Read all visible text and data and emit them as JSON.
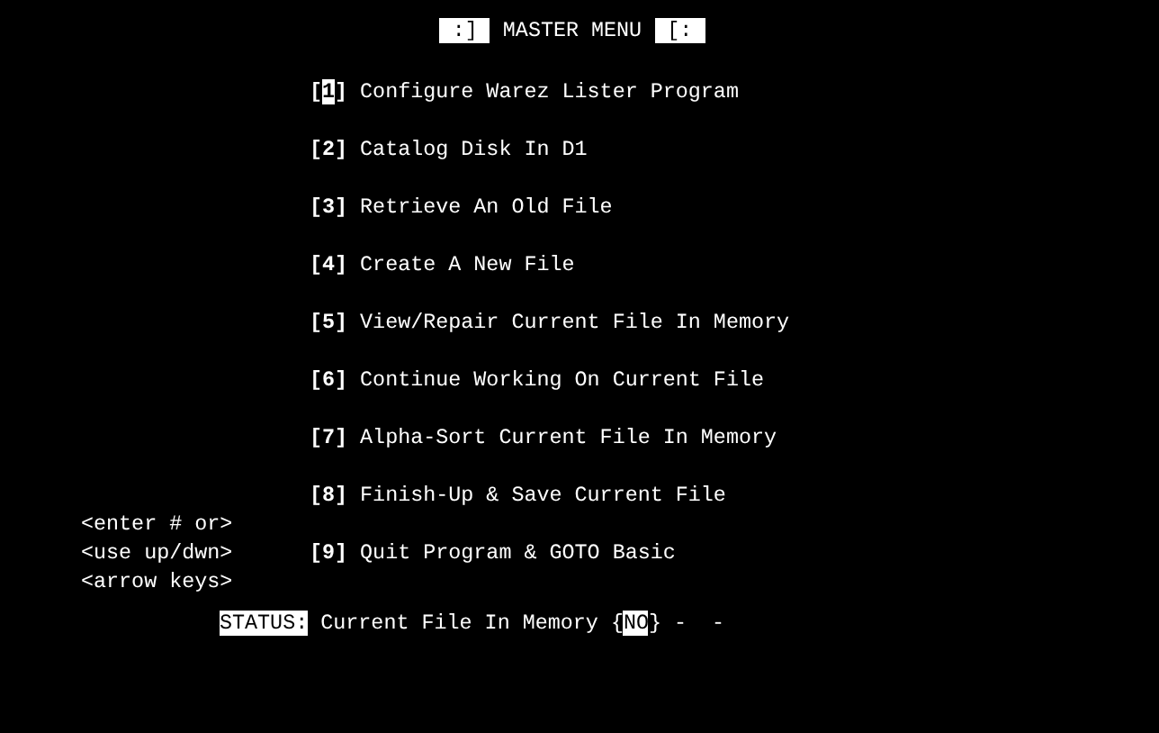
{
  "title": {
    "left_badge": ":]",
    "text": "MASTER MENU",
    "right_badge": "[:"
  },
  "menu": [
    {
      "open": "[",
      "number": "1",
      "close": "]",
      "label": "Configure Warez Lister Program",
      "selected": true
    },
    {
      "open": "[",
      "number": "2",
      "close": "]",
      "label": "Catalog Disk In D1",
      "selected": false
    },
    {
      "open": "[",
      "number": "3",
      "close": "]",
      "label": "Retrieve An Old File",
      "selected": false
    },
    {
      "open": "[",
      "number": "4",
      "close": "]",
      "label": "Create A New File",
      "selected": false
    },
    {
      "open": "[",
      "number": "5",
      "close": "]",
      "label": "View/Repair Current File In Memory",
      "selected": false
    },
    {
      "open": "[",
      "number": "6",
      "close": "]",
      "label": "Continue Working On Current File",
      "selected": false
    },
    {
      "open": "[",
      "number": "7",
      "close": "]",
      "label": "Alpha-Sort Current File In Memory",
      "selected": false
    },
    {
      "open": "[",
      "number": "8",
      "close": "]",
      "label": "Finish-Up & Save Current File",
      "selected": false
    },
    {
      "open": "[",
      "number": "9",
      "close": "]",
      "label": "Quit Program & GOTO Basic",
      "selected": false
    }
  ],
  "hints": [
    "<enter # or>",
    "<use up/dwn>",
    "<arrow keys>"
  ],
  "status": {
    "label": "STATUS:",
    "text": "Current File In Memory {",
    "value": "NO",
    "suffix": "} -  -"
  }
}
